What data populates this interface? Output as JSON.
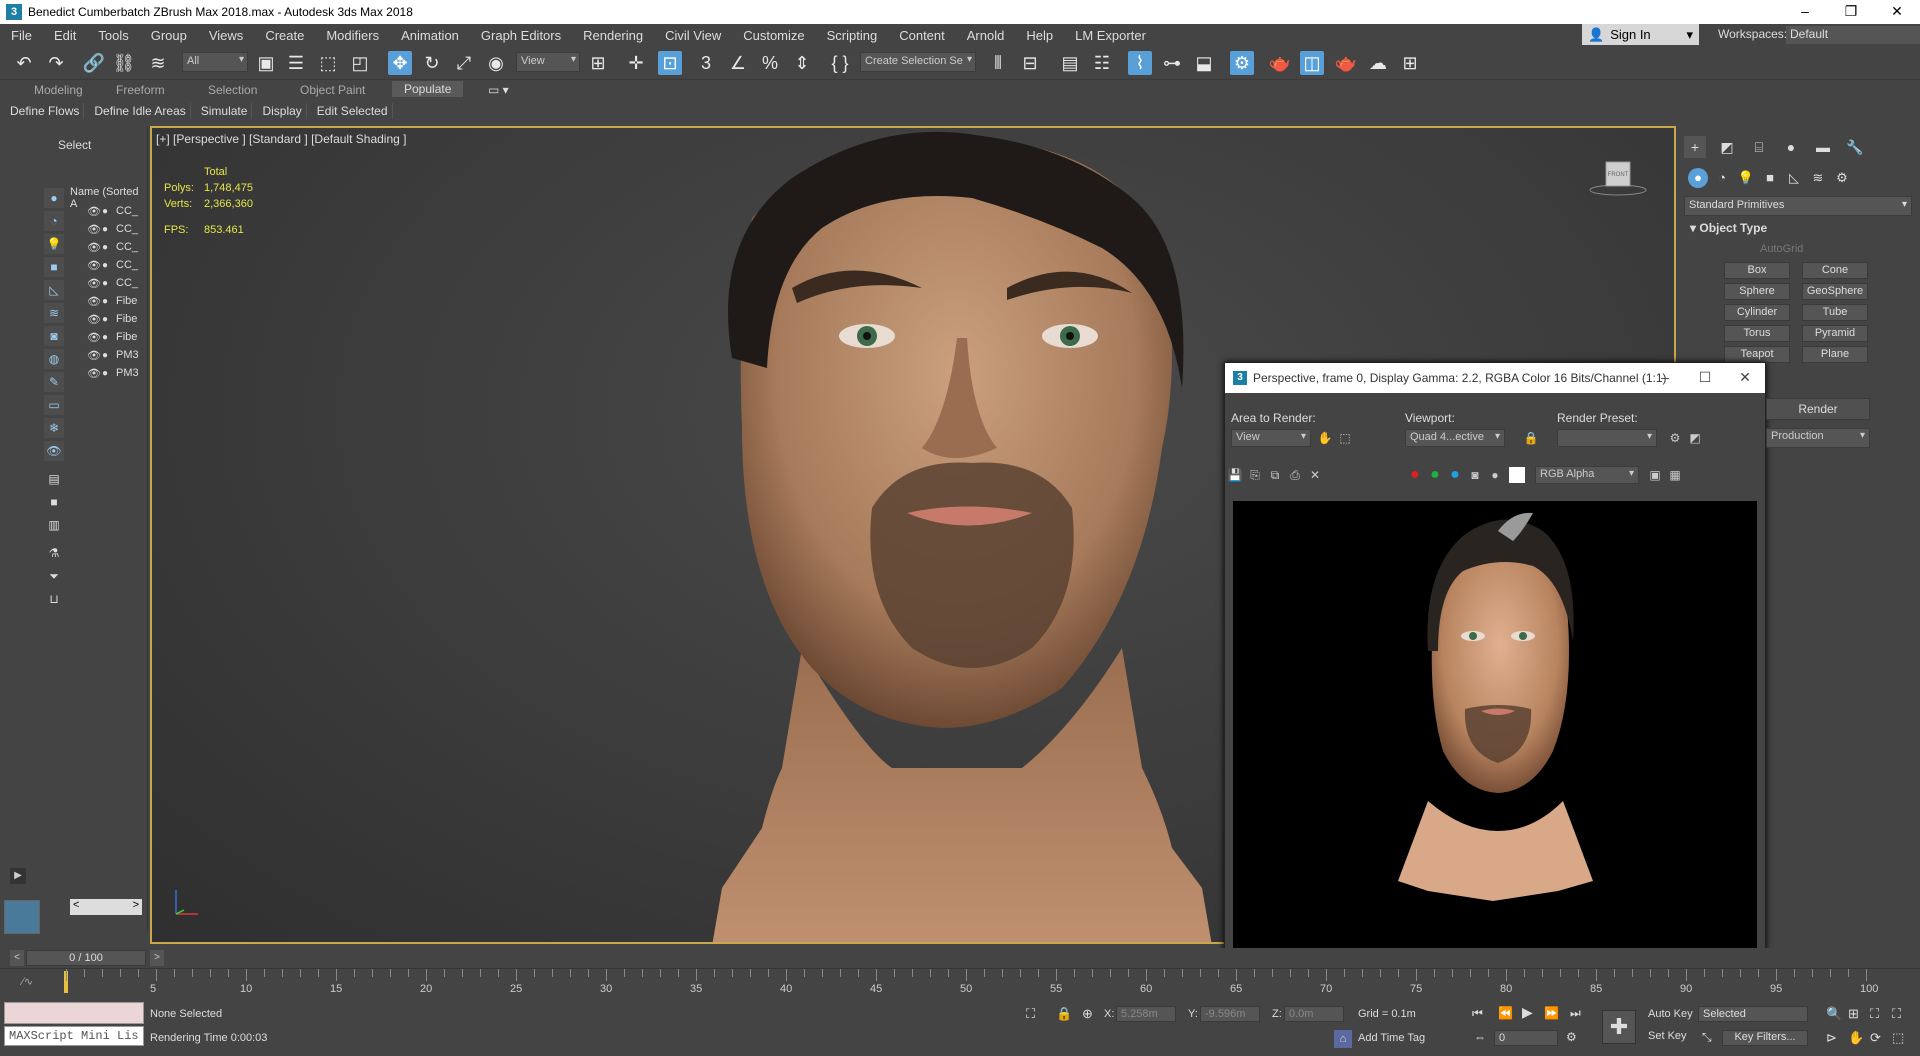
{
  "window": {
    "title": "Benedict Cumberbatch ZBrush Max 2018.max - Autodesk 3ds Max 2018",
    "app_icon": "3"
  },
  "menu": [
    "File",
    "Edit",
    "Tools",
    "Group",
    "Views",
    "Create",
    "Modifiers",
    "Animation",
    "Graph Editors",
    "Rendering",
    "Civil View",
    "Customize",
    "Scripting",
    "Content",
    "Arnold",
    "Help",
    "LM Exporter"
  ],
  "account": {
    "sign_in": "Sign In",
    "workspaces_label": "Workspaces:",
    "workspace_value": "Default"
  },
  "toolbar": {
    "filter_value": "All",
    "ref_coord_value": "View",
    "selection_set_value": "Create Selection Se"
  },
  "ribbon": {
    "tabs": [
      "Modeling",
      "Freeform",
      "Selection",
      "Object Paint",
      "Populate"
    ],
    "active_tab": "Populate",
    "subtabs": [
      "Define Flows",
      "Define Idle Areas",
      "Simulate",
      "Display",
      "Edit Selected"
    ]
  },
  "scene_explorer": {
    "select_label": "Select",
    "column_header": "Name (Sorted A",
    "items": [
      "CC_",
      "CC_",
      "CC_",
      "CC_",
      "CC_",
      "Fibe",
      "Fibe",
      "Fibe",
      "PM3",
      "PM3"
    ]
  },
  "viewport": {
    "label": "[+] [Perspective ] [Standard ] [Default Shading ]",
    "stats": {
      "total_label": "Total",
      "polys_label": "Polys:",
      "polys_value": "1,748,475",
      "verts_label": "Verts:",
      "verts_value": "2,366,360",
      "fps_label": "FPS:",
      "fps_value": "853.461"
    },
    "viewcube_label": "FRONT"
  },
  "render_window": {
    "title": "Perspective, frame 0, Display Gamma: 2.2, RGBA Color 16 Bits/Channel (1:1)",
    "area_label": "Area to Render:",
    "area_value": "View",
    "viewport_label": "Viewport:",
    "viewport_value": "Quad 4...ective",
    "preset_label": "Render Preset:",
    "preset_value": "",
    "render_button": "Render",
    "production_value": "Production",
    "channel_value": "RGB Alpha"
  },
  "command_panel": {
    "category": "Standard Primitives",
    "rollout_title": "Object Type",
    "autogrid": "AutoGrid",
    "buttons": [
      "Box",
      "Cone",
      "Sphere",
      "GeoSphere",
      "Cylinder",
      "Tube",
      "Torus",
      "Pyramid",
      "Teapot",
      "Plane"
    ]
  },
  "timeline": {
    "frame_display": "0 / 100",
    "ticks": [
      5,
      10,
      15,
      20,
      25,
      30,
      35,
      40,
      45,
      50,
      55,
      60,
      65,
      70,
      75,
      80,
      85,
      90,
      95,
      100
    ]
  },
  "status": {
    "maxscript_label": "MAXScript Mini Lis",
    "selection": "None Selected",
    "render_time": "Rendering Time  0:00:03",
    "x_label": "X:",
    "x_value": "5.258m",
    "y_label": "Y:",
    "y_value": "-9.596m",
    "z_label": "Z:",
    "z_value": "0.0m",
    "grid": "Grid = 0.1m",
    "add_time_tag": "Add Time Tag",
    "auto_key": "Auto Key",
    "set_key": "Set Key",
    "selected_value": "Selected",
    "key_filters": "Key Filters...",
    "frame_value": "0"
  },
  "colors": {
    "accent": "#5aa0d8",
    "viewport_border": "#c9a74b",
    "stats_text": "#e6e64a"
  }
}
